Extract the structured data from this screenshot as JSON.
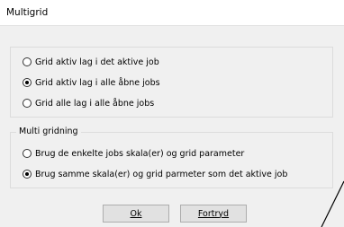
{
  "window": {
    "title": "Multigrid"
  },
  "group1": {
    "options": [
      {
        "label": "Grid aktiv lag i det aktive job",
        "checked": false
      },
      {
        "label": "Grid aktiv lag i alle åbne jobs",
        "checked": true
      },
      {
        "label": "Grid alle lag i alle åbne jobs",
        "checked": false
      }
    ]
  },
  "group2": {
    "title": "Multi gridning",
    "options": [
      {
        "label": "Brug de enkelte jobs skala(er) og grid parameter",
        "checked": false
      },
      {
        "label": "Brug samme skala(er) og grid parmeter som det aktive job",
        "checked": true
      }
    ]
  },
  "buttons": {
    "ok": "Ok",
    "cancel": "Fortryd"
  }
}
